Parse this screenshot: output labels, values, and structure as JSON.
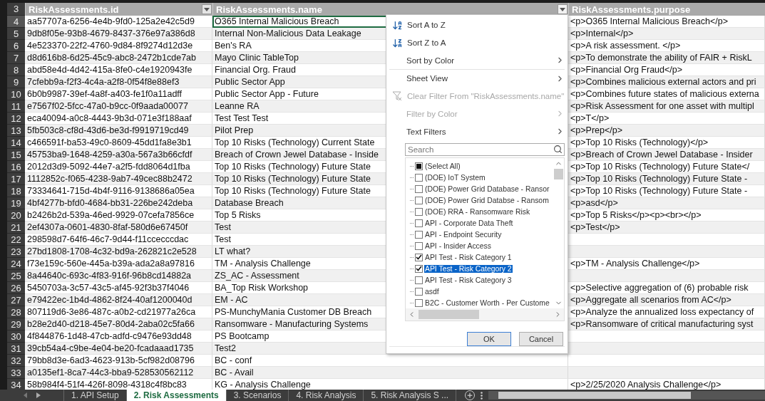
{
  "header": {
    "number": "3",
    "columns": [
      {
        "label": "RiskAssessments.id",
        "filter_button": true
      },
      {
        "label": "RiskAssessments.name",
        "filter_button": true
      },
      {
        "label": "RiskAssessments.purpose",
        "filter_button": false
      }
    ]
  },
  "rows": [
    {
      "number": "4",
      "id": "aa57707a-6256-4e4b-9fd0-125a2e42c5d9",
      "name": "O365 Internal Malicious Breach",
      "purpose": "<p>O365 Internal Malicious Breach</p>",
      "selected": true
    },
    {
      "number": "5",
      "id": "9db8f05e-93b8-4679-8437-376e97a386d8",
      "name": "Internal Non-Malicious Data Leakage",
      "purpose": "<p>Internal</p>",
      "selected": false
    },
    {
      "number": "6",
      "id": "4e523370-22f2-4760-9d84-8f9274d12d3e",
      "name": "Ben's RA",
      "purpose": "<p>A risk assessment. </p>",
      "selected": false
    },
    {
      "number": "7",
      "id": "d8d616b8-6d25-45c9-abc8-2472b1cde7ab",
      "name": "Mayo Clinic TableTop",
      "purpose": "<p>To demonstrate the ability of FAIR + RiskL",
      "selected": false
    },
    {
      "number": "8",
      "id": "abd58e4d-4d42-415a-8fe0-c4e1920943fe",
      "name": "Financial Org. Fraud",
      "purpose": "<p>Financial Org Fraud</p>",
      "selected": false
    },
    {
      "number": "9",
      "id": "7cfebb9a-f2f3-4c4a-a2f8-0f54f8e88ef3",
      "name": "Public Sector App",
      "purpose": "<p>Combines malicious external actors and pri",
      "selected": false
    },
    {
      "number": "10",
      "id": "6b0b9987-39ef-4a8f-a403-fe1f0a11adff",
      "name": "Public Sector App - Future",
      "purpose": "<p>Combines future states of malicious externa",
      "selected": false
    },
    {
      "number": "11",
      "id": "e7567f02-5fcc-47a0-b9cc-0f9aada00077",
      "name": "Leanne RA",
      "purpose": "<p>Risk Assessment for one asset with multipl",
      "selected": false
    },
    {
      "number": "12",
      "id": "eca40094-a0c8-4443-9b3d-071e3f188aaf",
      "name": "Test Test Test",
      "purpose": "<p>T</p>",
      "selected": false
    },
    {
      "number": "13",
      "id": "5fb503c8-cf8d-43d6-be3d-f9919719cd49",
      "name": "Pilot Prep",
      "purpose": "<p>Prep</p>",
      "selected": false
    },
    {
      "number": "14",
      "id": "c466591f-ba53-49c0-8609-45dd1fa8e3b1",
      "name": "Top 10 Risks (Technology) Current State",
      "purpose": "<p>Top 10 Risks (Technology)</p>",
      "selected": false
    },
    {
      "number": "15",
      "id": "45753ba9-1648-4259-a30a-567a3b66cfdf",
      "name": "Breach of Crown Jewel Database - Inside",
      "purpose": "<p>Breach of Crown Jewel Database - Insider",
      "selected": false
    },
    {
      "number": "16",
      "id": "2012d3d9-5092-44e7-a2f5-fdd8064d1fba",
      "name": "Top 10 Risks (Technology) Future State",
      "purpose": "<p>Top 10 Risks (Technology) Future State</",
      "selected": false
    },
    {
      "number": "17",
      "id": "1112852c-f065-4238-9ab7-49cec88b2472",
      "name": "Top 10 Risks (Technology) Future State",
      "purpose": "<p>Top 10 Risks (Technology) Future State -",
      "selected": false
    },
    {
      "number": "18",
      "id": "73334641-715d-4b4f-9116-9138686a05ea",
      "name": "Top 10 Risks (Technology) Future State",
      "purpose": "<p>Top 10 Risks (Technology) Future State -",
      "selected": false
    },
    {
      "number": "19",
      "id": "4bf4277b-bfd0-4684-bb31-226be242deba",
      "name": "Database Breach",
      "purpose": "<p>asd</p>",
      "selected": false
    },
    {
      "number": "20",
      "id": "b2426b2d-539a-46ed-9929-07cefa7856ce",
      "name": "Top 5 Risks",
      "purpose": "<p>Top 5 Risks</p><p><br></p>",
      "selected": false
    },
    {
      "number": "21",
      "id": "2ef4307a-0601-4830-8faf-580d6e67450f",
      "name": "Test",
      "purpose": "<p>Test</p>",
      "selected": false
    },
    {
      "number": "22",
      "id": "298598d7-64f6-46c7-9d44-f11ccecccdac",
      "name": "Test",
      "selected": false
    },
    {
      "number": "23",
      "id": "27bd1808-1708-4c32-bd9a-262821c2e528",
      "name": "LT what?",
      "selected": false
    },
    {
      "number": "24",
      "id": "f73e159c-560e-445a-b39a-ada2a8a97816",
      "name": "TM - Analysis Challenge",
      "purpose": "<p>TM - Analysis Challenge</p>",
      "selected": false
    },
    {
      "number": "25",
      "id": "8a44640c-693c-4f83-916f-96b8cd14882a",
      "name": "ZS_AC - Assessment",
      "selected": false
    },
    {
      "number": "26",
      "id": "5450703a-3c57-43c5-af45-92f3b37f4046",
      "name": "BA_Top Risk Workshop",
      "purpose": "<p>Selective aggregation of (6) probable risk",
      "selected": false
    },
    {
      "number": "27",
      "id": "e79422ec-1b4d-4862-8f24-40af1200040d",
      "name": "EM - AC",
      "purpose": "<p>Aggregate all scenarios from AC</p>",
      "selected": false
    },
    {
      "number": "28",
      "id": "807119d6-3e86-487c-a0b2-cd21977a26ca",
      "name": "PS-MunchyMania Customer DB Breach",
      "purpose": "<p>Analyze the annualized loss expectancy of",
      "selected": false
    },
    {
      "number": "29",
      "id": "b28e2d40-d218-45e7-80d4-2aba02c5fa66",
      "name": "Ransomware - Manufacturing Systems",
      "purpose": "<p>Ransomware of critical manufacturing syst",
      "selected": false
    },
    {
      "number": "30",
      "id": "4f844876-1d48-47cb-adfd-c9476e93dd48",
      "name": "PS Bootcamp",
      "selected": false
    },
    {
      "number": "31",
      "id": "39cb54a4-c9be-4e04-be20-fcadaaad1735",
      "name": "Test2",
      "selected": false
    },
    {
      "number": "32",
      "id": "79bb8d3e-6ad3-4623-913b-5cf982d08796",
      "name": "BC - conf",
      "selected": false
    },
    {
      "number": "33",
      "id": "a0135ef1-8ca7-44c3-bba9-528530562112",
      "name": "BC - Avail",
      "selected": false
    },
    {
      "number": "34",
      "id": "58b984f4-51f4-426f-8098-4318c4f8bc83",
      "name": "KG - Analysis Challenge",
      "purpose": "<p>2/25/2020 Analysis Challenge</p>",
      "selected": false
    }
  ],
  "filter_menu": {
    "commands": [
      {
        "kind": "sort-asc",
        "label": "Sort A to Z",
        "disabled": false
      },
      {
        "kind": "sort-desc",
        "label": "Sort Z to A",
        "disabled": false
      },
      {
        "kind": "submenu",
        "label": "Sort by Color",
        "disabled": false
      },
      {
        "kind": "submenu",
        "label": "Sheet View",
        "disabled": false
      },
      {
        "kind": "clear-filter",
        "label": "Clear Filter From \"RiskAssessments.name\"",
        "disabled": true
      },
      {
        "kind": "submenu",
        "label": "Filter by Color",
        "disabled": true
      },
      {
        "kind": "submenu",
        "label": "Text Filters",
        "disabled": false
      }
    ],
    "search": {
      "placeholder": "Search"
    },
    "values": [
      {
        "label": "(Select All)",
        "checked": false,
        "partial": true,
        "selected": false
      },
      {
        "label": "(DOE) IoT System",
        "checked": false,
        "partial": false,
        "selected": false
      },
      {
        "label": "(DOE) Power Grid Database - Ransor",
        "checked": false,
        "partial": false,
        "selected": false
      },
      {
        "label": "(DOE) Power Grid Databse - Ransom",
        "checked": false,
        "partial": false,
        "selected": false
      },
      {
        "label": "(DOE) RRA - Ransomware Risk",
        "checked": false,
        "partial": false,
        "selected": false
      },
      {
        "label": "API - Corporate Data Theft",
        "checked": false,
        "partial": false,
        "selected": false
      },
      {
        "label": "API - Endpoint Security",
        "checked": false,
        "partial": false,
        "selected": false
      },
      {
        "label": "API - Insider Access",
        "checked": false,
        "partial": false,
        "selected": false
      },
      {
        "label": "API Test - Risk Category 1",
        "checked": true,
        "partial": false,
        "selected": false
      },
      {
        "label": "API Test - Risk Category 2",
        "checked": true,
        "partial": false,
        "selected": true
      },
      {
        "label": "API Test - Risk Category 3",
        "checked": false,
        "partial": false,
        "selected": false
      },
      {
        "label": "asdf",
        "checked": false,
        "partial": false,
        "selected": false
      },
      {
        "label": "B2C - Customer Worth - Per Custome",
        "checked": false,
        "partial": false,
        "selected": false
      }
    ],
    "buttons": [
      {
        "label": "OK",
        "default": true
      },
      {
        "label": "Cancel",
        "default": false
      }
    ]
  },
  "sheet_tabs": [
    {
      "label": "1. API Setup",
      "selected": false
    },
    {
      "label": "2. Risk Assessments",
      "selected": true
    },
    {
      "label": "3. Scenarios",
      "selected": false
    },
    {
      "label": "4. Risk Analysis",
      "selected": false
    },
    {
      "label": "5. Risk Analysis S ...",
      "selected": false
    }
  ]
}
